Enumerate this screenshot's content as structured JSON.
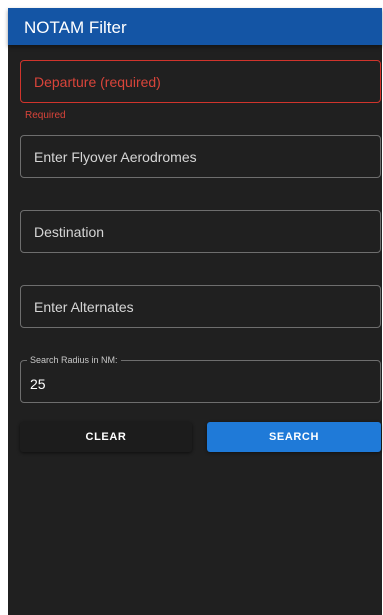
{
  "header": {
    "title": "NOTAM Filter"
  },
  "form": {
    "departure": {
      "placeholder": "Departure (required)",
      "helper": "Required"
    },
    "flyover": {
      "placeholder": "Enter Flyover Aerodromes"
    },
    "destination": {
      "placeholder": "Destination"
    },
    "alternates": {
      "placeholder": "Enter Alternates"
    },
    "radius": {
      "label": "Search Radius in NM:",
      "value": "25"
    }
  },
  "actions": {
    "clear_label": "CLEAR",
    "search_label": "SEARCH"
  },
  "colors": {
    "header": "#1455a5",
    "background": "#202020",
    "error": "#d9443a",
    "primary": "#1f7ad8"
  }
}
